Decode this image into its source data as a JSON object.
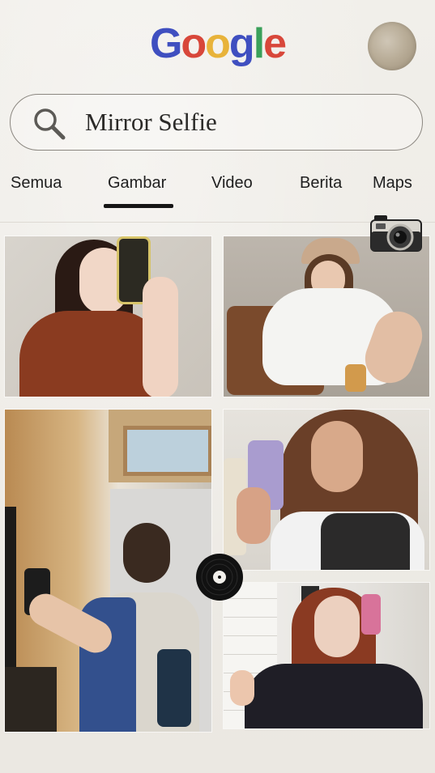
{
  "header": {
    "logo_letters": [
      {
        "char": "G",
        "color": "#3f4fc0"
      },
      {
        "char": "o",
        "color": "#d8473a"
      },
      {
        "char": "o",
        "color": "#e8b33a"
      },
      {
        "char": "g",
        "color": "#3f4fc0"
      },
      {
        "char": "l",
        "color": "#3aa05a"
      },
      {
        "char": "e",
        "color": "#d8473a"
      }
    ],
    "avatar": "profile-avatar"
  },
  "search": {
    "icon": "search-icon",
    "value": "Mirror Selfie"
  },
  "tabs": [
    {
      "label": "Semua",
      "active": false
    },
    {
      "label": "Gambar",
      "active": true
    },
    {
      "label": "Video",
      "active": false
    },
    {
      "label": "Berita",
      "active": false
    },
    {
      "label": "Maps",
      "active": false
    }
  ],
  "results": [
    {
      "name": "result-image-1",
      "description_icon": "image"
    },
    {
      "name": "result-image-2",
      "description_icon": "image"
    },
    {
      "name": "result-image-3",
      "description_icon": "image"
    },
    {
      "name": "result-image-4",
      "description_icon": "image"
    },
    {
      "name": "result-image-5",
      "description_icon": "image"
    }
  ],
  "decorations": {
    "camera": "camera-sticker-icon",
    "vinyl": "vinyl-record-icon"
  },
  "colors": {
    "background": "#efece7",
    "tab_underline": "#151515"
  }
}
